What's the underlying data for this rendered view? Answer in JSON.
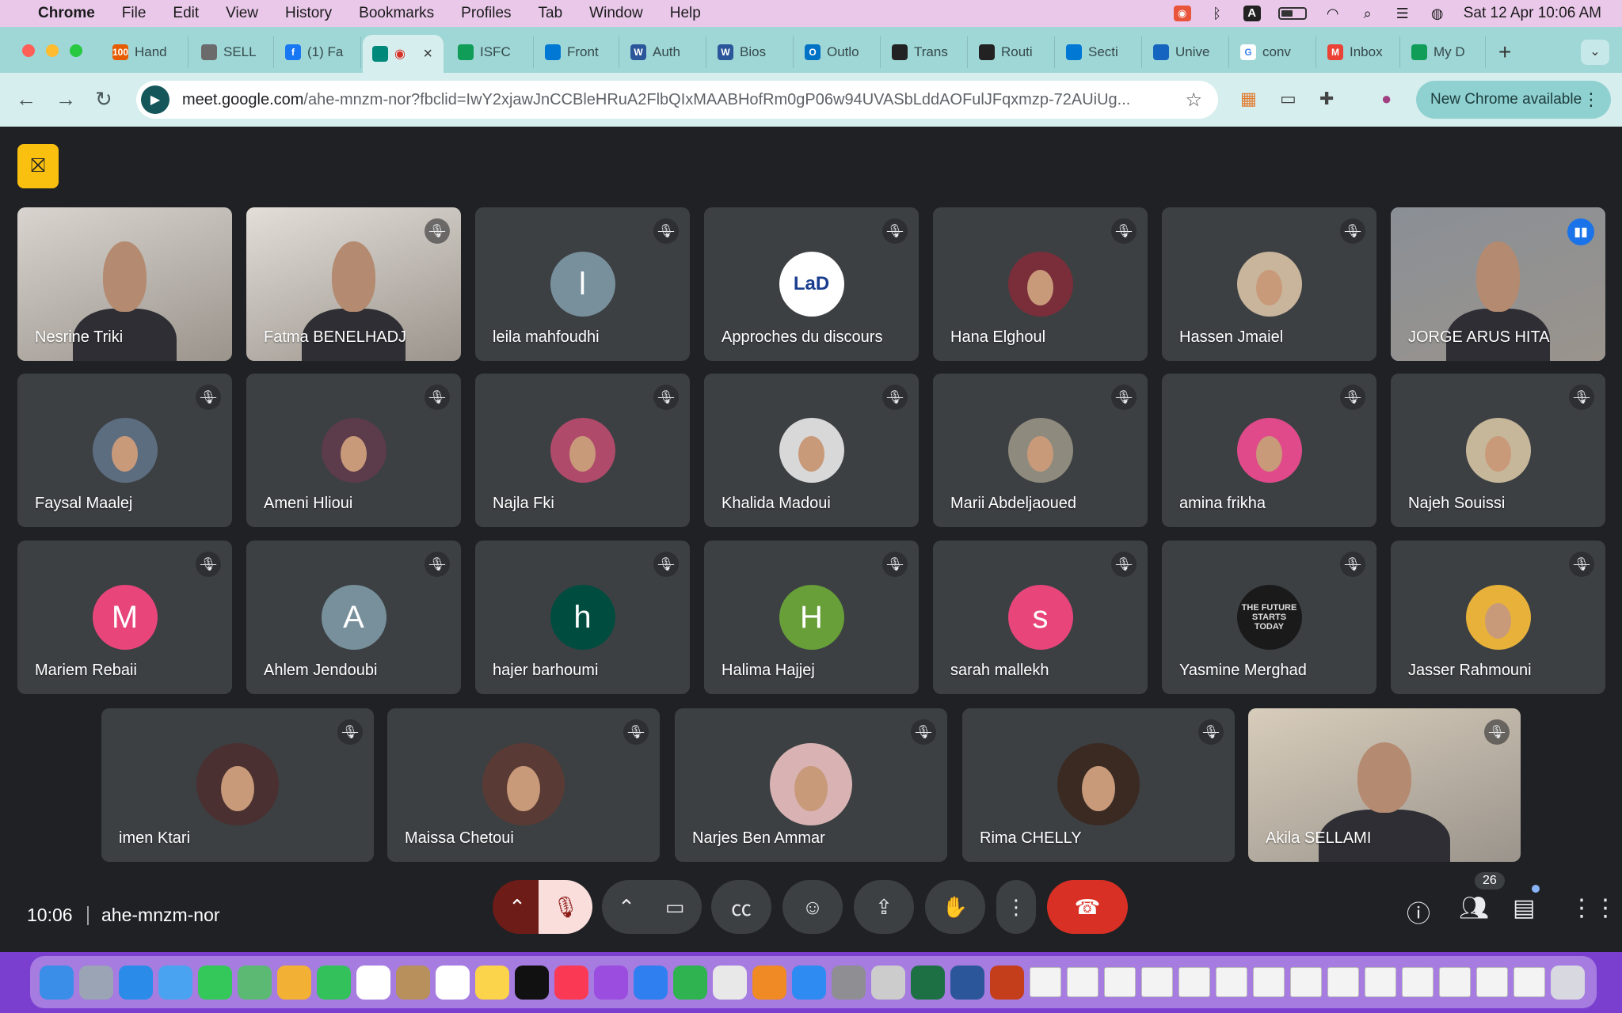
{
  "menubar": {
    "app": "Chrome",
    "items": [
      "File",
      "Edit",
      "View",
      "History",
      "Bookmarks",
      "Profiles",
      "Tab",
      "Window",
      "Help"
    ],
    "datetime": "Sat 12 Apr  10:06 AM"
  },
  "tabs": [
    {
      "label": "Hand",
      "fav_color": "#e65c00",
      "fav_text": "100"
    },
    {
      "label": "SELL",
      "fav_color": "#6b6b6b",
      "fav_text": ""
    },
    {
      "label": "(1) Fa",
      "fav_color": "#1877f2",
      "fav_text": "f"
    },
    {
      "label": "",
      "fav_color": "#00897b",
      "fav_text": "",
      "active": true
    },
    {
      "label": "ISFC",
      "fav_color": "#0f9d58",
      "fav_text": ""
    },
    {
      "label": "Front",
      "fav_color": "#0078d4",
      "fav_text": ""
    },
    {
      "label": "Auth",
      "fav_color": "#2b579a",
      "fav_text": "W"
    },
    {
      "label": "Bios",
      "fav_color": "#2b579a",
      "fav_text": "W"
    },
    {
      "label": "Outlo",
      "fav_color": "#0072c6",
      "fav_text": "O"
    },
    {
      "label": "Trans",
      "fav_color": "#222222",
      "fav_text": ""
    },
    {
      "label": "Routi",
      "fav_color": "#222222",
      "fav_text": ""
    },
    {
      "label": "Secti",
      "fav_color": "#0078d4",
      "fav_text": ""
    },
    {
      "label": "Unive",
      "fav_color": "#1565c0",
      "fav_text": ""
    },
    {
      "label": "conv",
      "fav_color": "#ffffff",
      "fav_text": "G"
    },
    {
      "label": "Inbox",
      "fav_color": "#ea4335",
      "fav_text": "M"
    },
    {
      "label": "My D",
      "fav_color": "#0f9d58",
      "fav_text": ""
    }
  ],
  "toolbar": {
    "url_domain": "meet.google.com",
    "url_path": "/ahe-mnzm-nor?fbclid=IwY2xjawJnCCBleHRuA2FlbQIxMAABHofRm0gP06w94UVASbLddAOFulJFqxmzp-72AUiUg...",
    "new_chrome": "New Chrome available"
  },
  "participants": [
    {
      "name": "Nesrine Triki",
      "kind": "video",
      "bg": "#d9d4cf",
      "muted": false
    },
    {
      "name": "Fatma BENELHADJ",
      "kind": "video",
      "bg": "#e3ded8",
      "muted": true
    },
    {
      "name": "leila mahfoudhi",
      "kind": "letter",
      "letter": "l",
      "color": "#78909c",
      "muted": true
    },
    {
      "name": "Approches du discours",
      "kind": "photo",
      "color": "#ffffff",
      "muted": true,
      "logo": "LaD"
    },
    {
      "name": "Hana Elghoul",
      "kind": "photo",
      "color": "#7a2e3a",
      "muted": true
    },
    {
      "name": "Hassen Jmaiel",
      "kind": "photo",
      "color": "#c9b59c",
      "muted": true
    },
    {
      "name": "JORGE ARUS HITA",
      "kind": "video",
      "bg": "#8a8f96",
      "muted": false,
      "speaking": true
    },
    {
      "name": "Faysal Maalej",
      "kind": "photo",
      "color": "#5d6d80",
      "muted": true
    },
    {
      "name": "Ameni Hlioui",
      "kind": "photo",
      "color": "#5c3b4a",
      "muted": true
    },
    {
      "name": "Najla Fki",
      "kind": "photo",
      "color": "#b04a6a",
      "muted": true
    },
    {
      "name": "Khalida Madoui",
      "kind": "photo",
      "color": "#d8d8d8",
      "muted": true
    },
    {
      "name": "Marii Abdeljaoued",
      "kind": "photo",
      "color": "#8e8a7d",
      "muted": true
    },
    {
      "name": "amina frikha",
      "kind": "photo",
      "color": "#e04a8a",
      "muted": true
    },
    {
      "name": "Najeh Souissi",
      "kind": "photo",
      "color": "#c7b79a",
      "muted": true
    },
    {
      "name": "Mariem Rebaii",
      "kind": "letter",
      "letter": "M",
      "color": "#e8457b",
      "muted": true
    },
    {
      "name": "Ahlem Jendoubi",
      "kind": "letter",
      "letter": "A",
      "color": "#78909c",
      "muted": true
    },
    {
      "name": "hajer barhoumi",
      "kind": "letter",
      "letter": "h",
      "color": "#004d40",
      "muted": true
    },
    {
      "name": "Halima Hajjej",
      "kind": "letter",
      "letter": "H",
      "color": "#689f38",
      "muted": true
    },
    {
      "name": "sarah mallekh",
      "kind": "letter",
      "letter": "s",
      "color": "#e8457b",
      "muted": true
    },
    {
      "name": "Yasmine Merghad",
      "kind": "photo",
      "color": "#1a1a1a",
      "muted": true,
      "logo": "THE FUTURE STARTS TODAY"
    },
    {
      "name": "Jasser Rahmouni",
      "kind": "photo",
      "color": "#e8b23a",
      "muted": true
    },
    {
      "name": "imen Ktari",
      "kind": "photo",
      "color": "#4a3030",
      "muted": true
    },
    {
      "name": "Maissa Chetoui",
      "kind": "photo",
      "color": "#5a3a34",
      "muted": true
    },
    {
      "name": "Narjes Ben Ammar",
      "kind": "photo",
      "color": "#d9b3b3",
      "muted": true
    },
    {
      "name": "Rima CHELLY",
      "kind": "photo",
      "color": "#3a2a22",
      "muted": true
    },
    {
      "name": "Akila SELLAMI",
      "kind": "video",
      "bg": "#d8cdbb",
      "muted": true
    }
  ],
  "bottom": {
    "time": "10:06",
    "meeting_code": "ahe-mnzm-nor",
    "participant_count": "26"
  }
}
